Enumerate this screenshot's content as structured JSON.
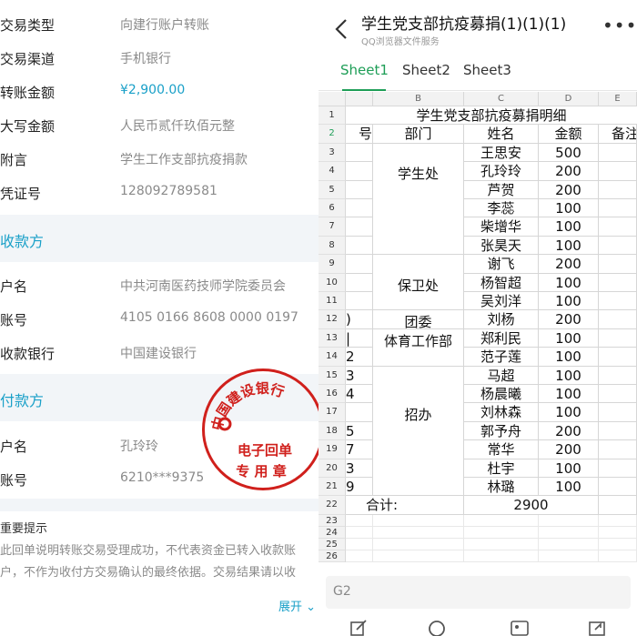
{
  "receipt": {
    "fields": [
      {
        "label": "交易类型",
        "value": "向建行账户转账"
      },
      {
        "label": "交易渠道",
        "value": "手机银行"
      },
      {
        "label": "转账金额",
        "value": "¥2,900.00"
      },
      {
        "label": "大写金额",
        "value": "人民币贰仟玖佰元整"
      },
      {
        "label": "附言",
        "value": "学生工作支部抗疫捐款"
      },
      {
        "label": "凭证号",
        "value": "128092789581"
      }
    ],
    "payee_title": "收款方",
    "payee": [
      {
        "label": "户名",
        "value": "中共河南医药技师学院委员会"
      },
      {
        "label": "账号",
        "value": "4105 0166 8608 0000 0197"
      },
      {
        "label": "收款银行",
        "value": "中国建设银行"
      }
    ],
    "payer_title": "付款方",
    "payer": [
      {
        "label": "户名",
        "value": "孔玲玲"
      },
      {
        "label": "账号",
        "value": "6210***9375"
      }
    ],
    "notice_title": "重要提示",
    "notice_text": "此回单说明转账交易受理成功，不代表资金已转入收款账户，不作为收付方交易确认的最终依据。交易结果请以收",
    "expand_label": "展开",
    "seal": {
      "ring": "中国建设银行",
      "line1": "电子回单",
      "line2": "专 用 章"
    }
  },
  "viewer": {
    "title": "学生党支部抗疫募捐(1)(1)(1)",
    "subtitle": "QQ浏览器文件服务",
    "tabs": [
      "Sheet1",
      "Sheet2",
      "Sheet3"
    ],
    "active_tab": 0,
    "formula_bar": "G2"
  },
  "sheet": {
    "columns": [
      "B",
      "C",
      "D",
      "E"
    ],
    "title": "学生党支部抗疫募捐明细",
    "headers": {
      "A": "号",
      "B": "部门",
      "C": "姓名",
      "D": "金额",
      "E": "备注"
    },
    "rows": [
      {
        "r": "3",
        "a": "",
        "c": "王思安",
        "d": "500"
      },
      {
        "r": "4",
        "a": "",
        "c": "孔玲玲",
        "d": "200"
      },
      {
        "r": "5",
        "a": "",
        "c": "芦贺",
        "d": "200"
      },
      {
        "r": "6",
        "a": "",
        "c": "李蕊",
        "d": "100"
      },
      {
        "r": "7",
        "a": "",
        "c": "柴增华",
        "d": "100"
      },
      {
        "r": "8",
        "a": "",
        "c": "张昊天",
        "d": "100"
      },
      {
        "r": "9",
        "a": "",
        "c": "谢飞",
        "d": "200"
      },
      {
        "r": "10",
        "a": "",
        "c": "杨智超",
        "d": "100"
      },
      {
        "r": "11",
        "a": "",
        "c": "吴刘洋",
        "d": "100"
      },
      {
        "r": "12",
        "a": ")",
        "c": "刘杨",
        "d": "200"
      },
      {
        "r": "13",
        "a": "|",
        "c": "郑利民",
        "d": "100"
      },
      {
        "r": "14",
        "a": "2",
        "c": "范子莲",
        "d": "100"
      },
      {
        "r": "15",
        "a": "3",
        "c": "马超",
        "d": "100"
      },
      {
        "r": "16",
        "a": "4",
        "c": "杨晨曦",
        "d": "100"
      },
      {
        "r": "17",
        "a": "",
        "c": "刘林森",
        "d": "100"
      },
      {
        "r": "18",
        "a": "5",
        "c": "郭予舟",
        "d": "200"
      },
      {
        "r": "19",
        "a": "7",
        "c": "常华",
        "d": "200"
      },
      {
        "r": "20",
        "a": "3",
        "c": "杜宇",
        "d": "100"
      },
      {
        "r": "21",
        "a": "9",
        "c": "林璐",
        "d": "100"
      }
    ],
    "depts": [
      {
        "label": "学生处"
      },
      {
        "label": "保卫处"
      },
      {
        "label": "团委"
      },
      {
        "label": "体育工作部"
      },
      {
        "label": "招办"
      }
    ],
    "total_label": "合计:",
    "total_value": "2900",
    "empty_rows": [
      "23",
      "24",
      "25",
      "26"
    ]
  }
}
